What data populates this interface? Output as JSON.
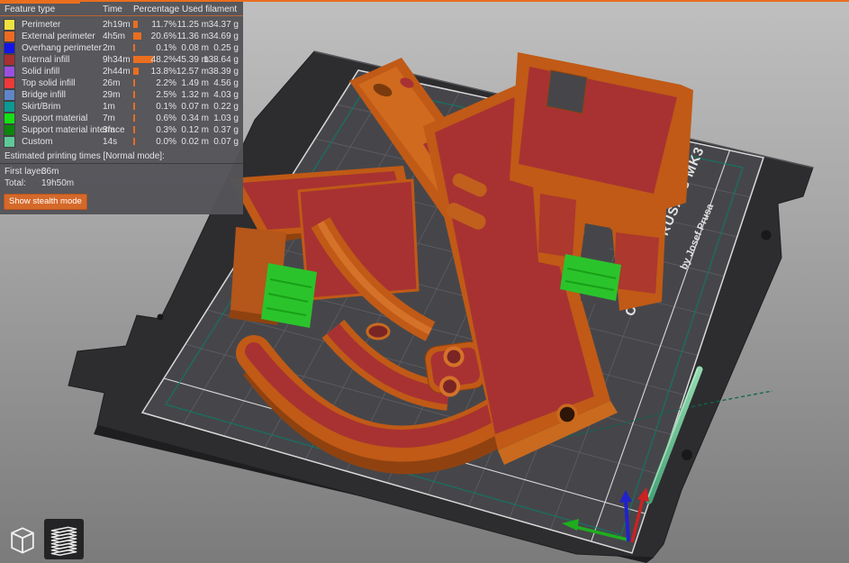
{
  "legend": {
    "header": {
      "feature_type": "Feature type",
      "time": "Time",
      "percentage": "Percentage",
      "used_filament": "Used filament"
    },
    "rows": [
      {
        "label": "Perimeter",
        "color": "#f0e23e",
        "time": "2h19m",
        "pct": 11.7,
        "percentage": "11.7%",
        "length": "11.25 m",
        "weight": "34.37 g"
      },
      {
        "label": "External perimeter",
        "color": "#ed6b21",
        "time": "4h5m",
        "pct": 20.6,
        "percentage": "20.6%",
        "length": "11.36 m",
        "weight": "34.69 g"
      },
      {
        "label": "Overhang perimeter",
        "color": "#1414e8",
        "time": "2m",
        "pct": 0.1,
        "percentage": "0.1%",
        "length": "0.08 m",
        "weight": "0.25 g"
      },
      {
        "label": "Internal infill",
        "color": "#a83030",
        "time": "9h34m",
        "pct": 48.2,
        "percentage": "48.2%",
        "length": "45.39 m",
        "weight": "138.64 g"
      },
      {
        "label": "Solid infill",
        "color": "#9a4fe0",
        "time": "2h44m",
        "pct": 13.8,
        "percentage": "13.8%",
        "length": "12.57 m",
        "weight": "38.39 g"
      },
      {
        "label": "Top solid infill",
        "color": "#ee3939",
        "time": "26m",
        "pct": 2.2,
        "percentage": "2.2%",
        "length": "1.49 m",
        "weight": "4.56 g"
      },
      {
        "label": "Bridge infill",
        "color": "#5f86c8",
        "time": "29m",
        "pct": 2.5,
        "percentage": "2.5%",
        "length": "1.32 m",
        "weight": "4.03 g"
      },
      {
        "label": "Skirt/Brim",
        "color": "#0c9a93",
        "time": "1m",
        "pct": 0.1,
        "percentage": "0.1%",
        "length": "0.07 m",
        "weight": "0.22 g"
      },
      {
        "label": "Support material",
        "color": "#15e015",
        "time": "7m",
        "pct": 0.6,
        "percentage": "0.6%",
        "length": "0.34 m",
        "weight": "1.03 g"
      },
      {
        "label": "Support material interface",
        "color": "#0c860c",
        "time": "3m",
        "pct": 0.3,
        "percentage": "0.3%",
        "length": "0.12 m",
        "weight": "0.37 g"
      },
      {
        "label": "Custom",
        "color": "#5ec998",
        "time": "14s",
        "pct": 0.0,
        "percentage": "0.0%",
        "length": "0.02 m",
        "weight": "0.07 g"
      }
    ],
    "estimated_title": "Estimated printing times [Normal mode]:",
    "first_layer_label": "First layer:",
    "first_layer_value": "36m",
    "total_label": "Total:",
    "total_value": "19h50m",
    "stealth_button": "Show stealth mode"
  },
  "bed": {
    "brand_text": "ORIGINAL PRUSA i3 MK3",
    "byline": "by Josef Prusa"
  },
  "colors": {
    "accent_orange": "#ea6e1f",
    "part_body": "#c05a16",
    "part_top_infill": "#a83232",
    "support_green": "#2bc32b",
    "bed_plate": "#2d2d2f",
    "bed_grid_area": "#46464a",
    "skirt_teal": "#0e7a66",
    "custom_rod_green": "#6fc596"
  }
}
